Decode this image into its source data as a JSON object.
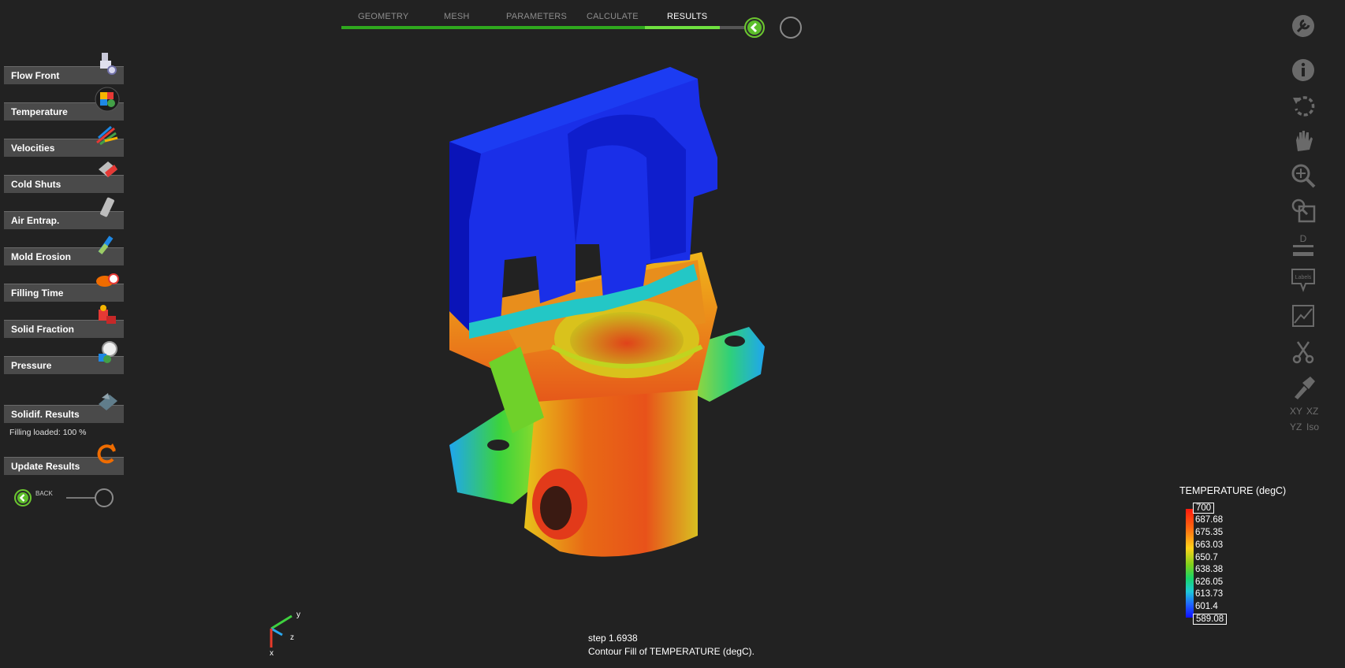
{
  "workflow": {
    "tabs": [
      {
        "label": "GEOMETRY",
        "active": false
      },
      {
        "label": "MESH",
        "active": false
      },
      {
        "label": "PARAMETERS",
        "active": false
      },
      {
        "label": "CALCULATE",
        "active": false
      },
      {
        "label": "RESULTS",
        "active": true
      }
    ],
    "accent_color": "#2fa81e"
  },
  "left_panel": {
    "results": [
      {
        "label": "Flow Front",
        "icon": "flow-front-icon"
      },
      {
        "label": "Temperature",
        "icon": "temperature-icon"
      },
      {
        "label": "Velocities",
        "icon": "velocities-icon"
      },
      {
        "label": "Cold Shuts",
        "icon": "cold-shuts-icon"
      },
      {
        "label": "Air Entrap.",
        "icon": "air-entrapment-icon"
      },
      {
        "label": "Mold Erosion",
        "icon": "mold-erosion-icon"
      },
      {
        "label": "Filling Time",
        "icon": "filling-time-icon"
      },
      {
        "label": "Solid Fraction",
        "icon": "solid-fraction-icon"
      },
      {
        "label": "Pressure",
        "icon": "pressure-icon"
      }
    ],
    "solidif_label": "Solidif. Results",
    "filling_loaded": "Filling loaded: 100 %",
    "update_label": "Update Results",
    "back_label": "BACK"
  },
  "toolbar": {
    "icons": [
      "settings-icon",
      "info-icon",
      "rotate-icon",
      "pan-hand-icon",
      "zoom-icon",
      "zoom-window-icon",
      "dimension-icon",
      "labels-icon",
      "chart-icon",
      "cut-plane-icon",
      "flashlight-icon"
    ],
    "dimension_text": "D",
    "labels_text": "Labels",
    "view_labels": [
      "XY",
      "XZ",
      "YZ",
      "Iso"
    ]
  },
  "legend": {
    "title": "TEMPERATURE (degC)",
    "ticks": [
      "700",
      "687.68",
      "675.35",
      "663.03",
      "650.7",
      "638.38",
      "626.05",
      "613.73",
      "601.4",
      "589.08"
    ]
  },
  "status": {
    "step": "step 1.6938",
    "description": "Contour Fill of TEMPERATURE (degC)."
  },
  "triad": {
    "x": "x",
    "y": "y",
    "z": "z"
  }
}
